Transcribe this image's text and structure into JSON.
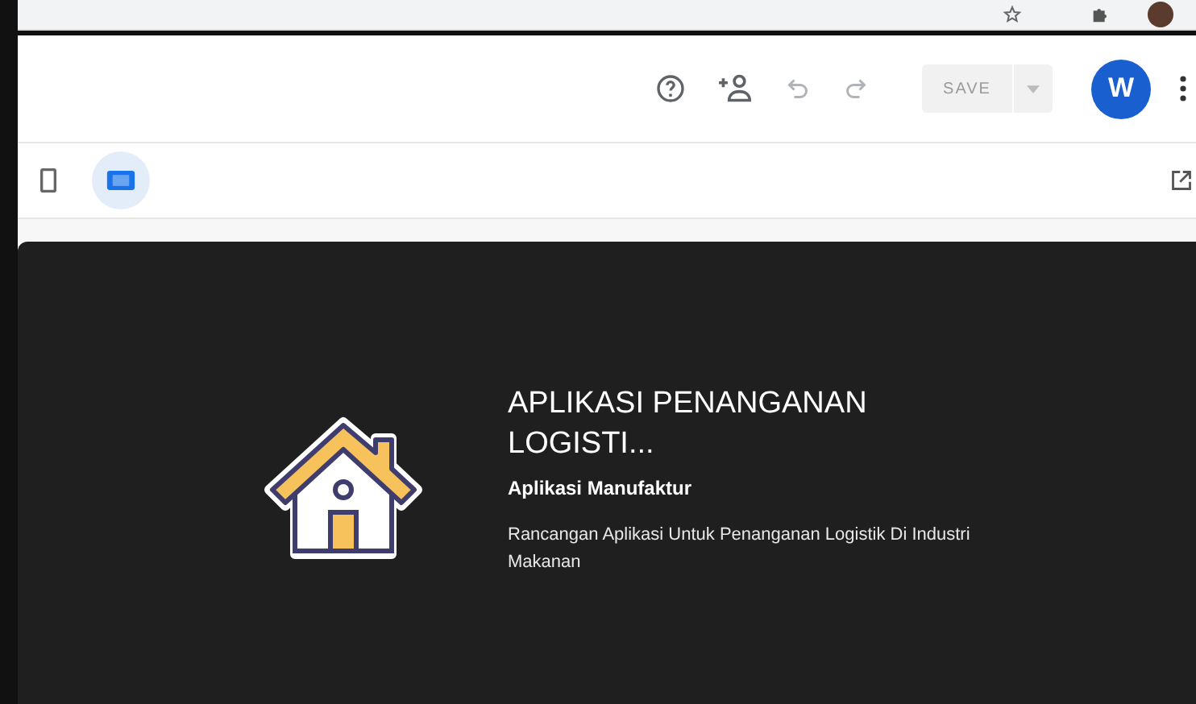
{
  "toolbar": {
    "save": {
      "label": "SAVE",
      "disabled": true
    },
    "avatar": "W"
  },
  "devices": [
    {
      "kind": "phone",
      "selected": false
    },
    {
      "kind": "tablet",
      "selected": true
    }
  ],
  "app_card": {
    "title": "APLIKASI PENANGANAN LOGISTI...",
    "subtitle": "Aplikasi Manufaktur",
    "description": "Rancangan Aplikasi Untuk Penanganan Logistik Di Industri Makanan"
  }
}
